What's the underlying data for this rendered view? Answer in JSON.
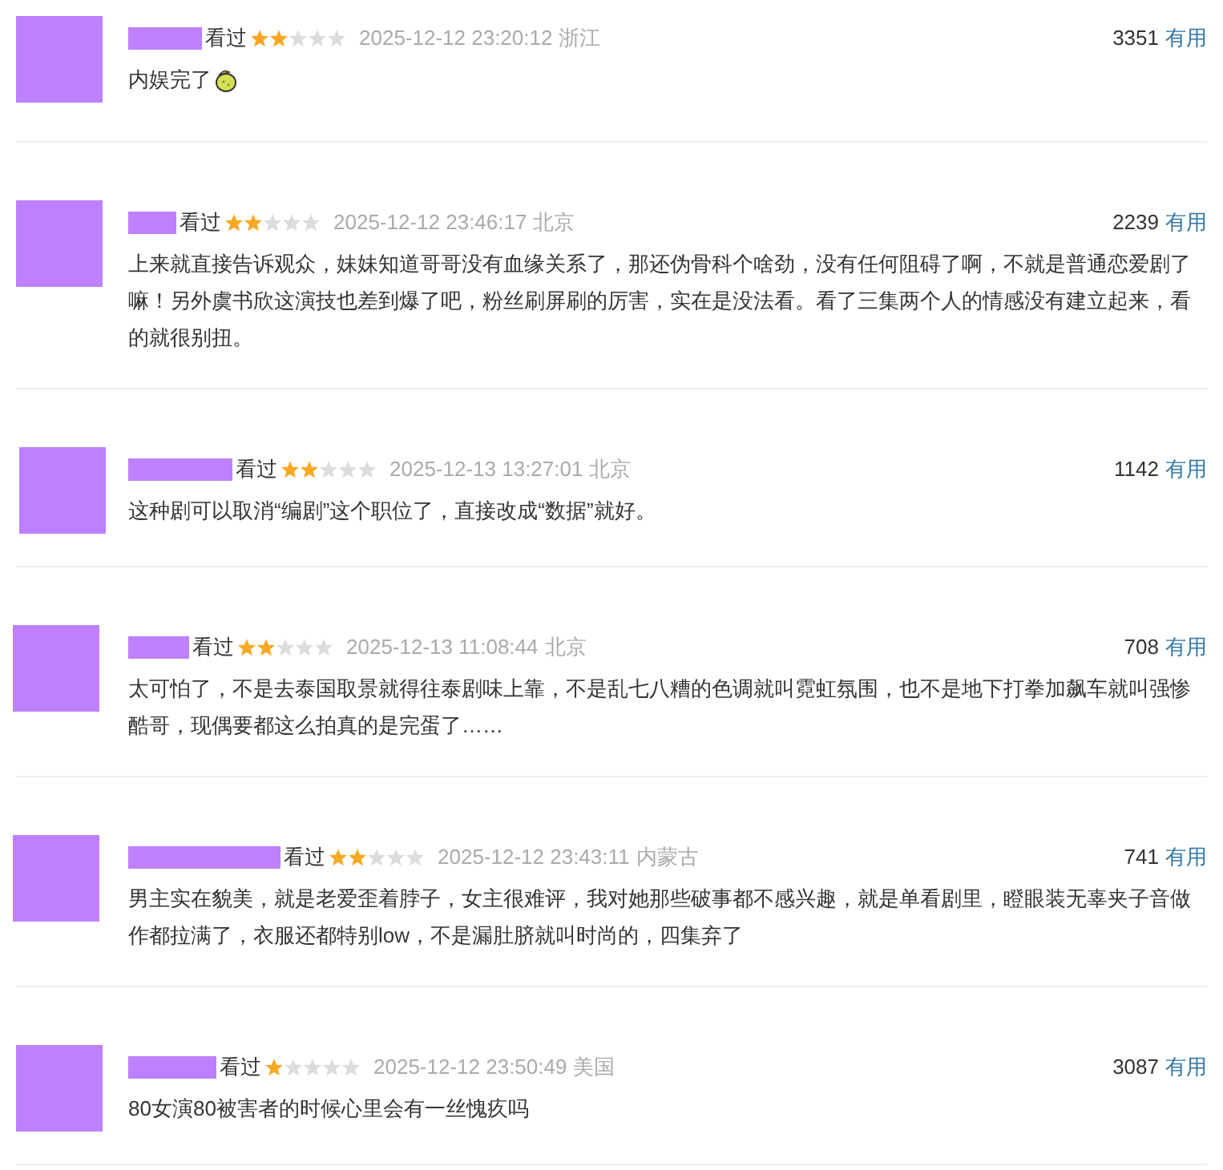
{
  "comments": [
    {
      "status": "看过",
      "stars": 2,
      "time": "2025-12-12 23:20:12",
      "location": "浙江",
      "votes": "3351",
      "vote_label": "有用",
      "text": "内娱完了",
      "trailing_icon": true
    },
    {
      "status": "看过",
      "stars": 2,
      "time": "2025-12-12 23:46:17",
      "location": "北京",
      "votes": "2239",
      "vote_label": "有用",
      "text": "上来就直接告诉观众，妹妹知道哥哥没有血缘关系了，那还伪骨科个啥劲，没有任何阻碍了啊，不就是普通恋爱剧了嘛！另外虞书欣这演技也差到爆了吧，粉丝刷屏刷的厉害，实在是没法看。看了三集两个人的情感没有建立起来，看的就很别扭。",
      "trailing_icon": false
    },
    {
      "status": "看过",
      "stars": 2,
      "time": "2025-12-13 13:27:01",
      "location": "北京",
      "votes": "1142",
      "vote_label": "有用",
      "text": "这种剧可以取消“编剧”这个职位了，直接改成“数据”就好。",
      "trailing_icon": false
    },
    {
      "status": "看过",
      "stars": 2,
      "time": "2025-12-13 11:08:44",
      "location": "北京",
      "votes": "708",
      "vote_label": "有用",
      "text": "太可怕了，不是去泰国取景就得往泰剧味上靠，不是乱七八糟的色调就叫霓虹氛围，也不是地下打拳加飙车就叫强惨酷哥，现偶要都这么拍真的是完蛋了……",
      "trailing_icon": false
    },
    {
      "status": "看过",
      "stars": 2,
      "time": "2025-12-12 23:43:11",
      "location": "内蒙古",
      "votes": "741",
      "vote_label": "有用",
      "text": "男主实在貌美，就是老爱歪着脖子，女主很难评，我对她那些破事都不感兴趣，就是单看剧里，瞪眼装无辜夹子音做作都拉满了，衣服还都特别low，不是漏肚脐就叫时尚的，四集弃了",
      "trailing_icon": false
    },
    {
      "status": "看过",
      "stars": 1,
      "time": "2025-12-12 23:50:49",
      "location": "美国",
      "votes": "3087",
      "vote_label": "有用",
      "text": "80女演80被害者的时候心里会有一丝愧疚吗",
      "trailing_icon": false
    }
  ]
}
